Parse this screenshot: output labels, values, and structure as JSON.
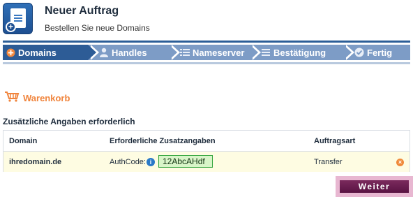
{
  "header": {
    "title": "Neuer Auftrag",
    "subtitle": "Bestellen Sie neue Domains",
    "icon": "new-order-document-icon"
  },
  "steps": [
    {
      "label": "Domains",
      "icon": "plus-circle-icon",
      "active": true
    },
    {
      "label": "Handles",
      "icon": "user-icon",
      "active": false
    },
    {
      "label": "Nameserver",
      "icon": "list-icon",
      "active": false
    },
    {
      "label": "Bestätigung",
      "icon": "list-icon",
      "active": false
    },
    {
      "label": "Fertig",
      "icon": "check-icon",
      "active": false
    }
  ],
  "cart": {
    "label": "Warenkorb",
    "icon": "cart-icon",
    "color": "#f0843c"
  },
  "section_title": "Zusätzliche Angaben erforderlich",
  "table": {
    "headers": [
      "Domain",
      "Erforderliche Zusatzangaben",
      "Auftragsart"
    ],
    "rows": [
      {
        "domain": "ihredomain.de",
        "extra_label": "AuthCode:",
        "authcode_value": "12AbcAHdf",
        "order_type": "Transfer"
      }
    ]
  },
  "button": {
    "label": "Weiter",
    "color": "#6d2152"
  },
  "colors": {
    "step_active": "#2d5c96",
    "step_inactive": "#7d9cc6",
    "row_highlight": "#fefce2"
  }
}
